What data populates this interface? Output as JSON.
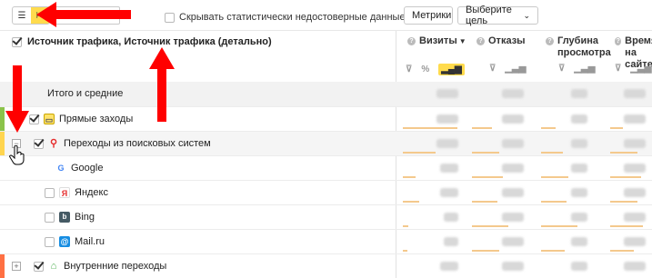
{
  "toolbar": {
    "hide_unreliable_label": "Скрывать статистически недостоверные данные",
    "metrics_button": "Метрики",
    "goal_select": "Выберите цель"
  },
  "dimensions_title": "Источник трафика, Источник трафика (детально)",
  "metric_columns": [
    {
      "name_line1": "Визиты",
      "name_line2": "",
      "sorted": true
    },
    {
      "name_line1": "Отказы",
      "name_line2": "",
      "sorted": false
    },
    {
      "name_line1": "Глубина",
      "name_line2": "просмотра",
      "sorted": false
    },
    {
      "name_line1": "Время",
      "name_line2": "на сайте",
      "sorted": false
    }
  ],
  "rows": [
    {
      "label": "Итого и средние",
      "type": "totals"
    },
    {
      "label": "Прямые заходы",
      "type": "group",
      "marker_color": "#8bc34a",
      "icon": "direct-visit-icon"
    },
    {
      "label": "Переходы из поисковых систем",
      "type": "group",
      "marker_color": "#ffd54f",
      "icon": "search-engine-icon"
    },
    {
      "label": "Google",
      "type": "child",
      "icon": "google-icon"
    },
    {
      "label": "Яндекс",
      "type": "child",
      "icon": "yandex-icon"
    },
    {
      "label": "Bing",
      "type": "child",
      "icon": "bing-icon"
    },
    {
      "label": "Mail.ru",
      "type": "child",
      "icon": "mailru-icon"
    },
    {
      "label": "Внутренние переходы",
      "type": "group",
      "marker_color": "#ff7043",
      "icon": "internal-link-icon"
    }
  ],
  "colors": {
    "accent_yellow": "#ffdb4d",
    "annotation_red": "#ff0000",
    "bar_orange": "#f4c98d"
  }
}
